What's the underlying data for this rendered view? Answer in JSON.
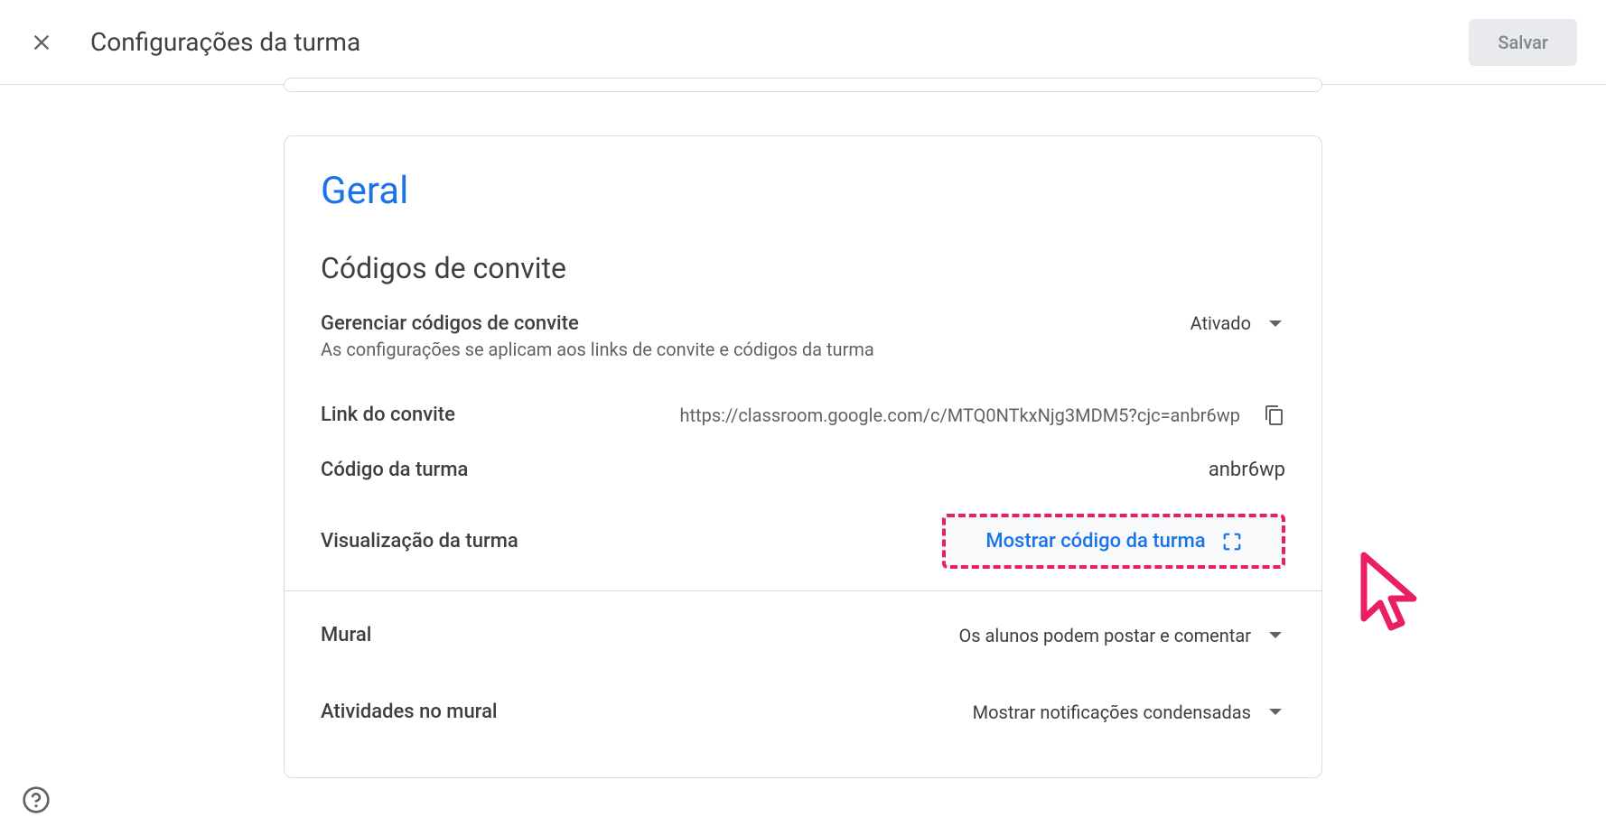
{
  "header": {
    "title": "Configurações da turma",
    "save_label": "Salvar"
  },
  "general": {
    "title": "Geral",
    "invite_codes_title": "Códigos de convite",
    "manage_codes": {
      "label": "Gerenciar códigos de convite",
      "desc": "As configurações se aplicam aos links de convite e códigos da turma",
      "value": "Ativado"
    },
    "invite_link": {
      "label": "Link do convite",
      "value": "https://classroom.google.com/c/MTQ0NTkxNjg3MDM5?cjc=anbr6wp"
    },
    "class_code": {
      "label": "Código da turma",
      "value": "anbr6wp"
    },
    "class_view": {
      "label": "Visualização da turma",
      "button": "Mostrar código da turma"
    },
    "mural": {
      "label": "Mural",
      "value": "Os alunos podem postar e comentar"
    },
    "activities": {
      "label": "Atividades no mural",
      "value": "Mostrar notificações condensadas"
    }
  }
}
